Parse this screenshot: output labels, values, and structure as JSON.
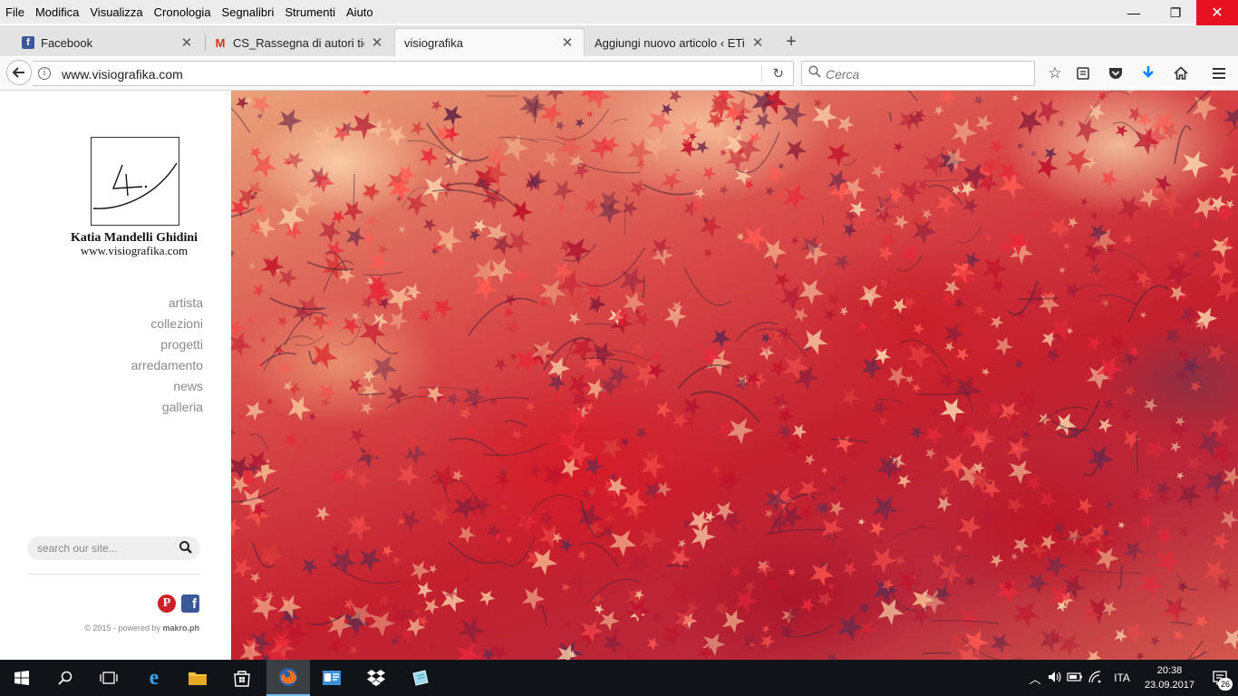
{
  "menubar": {
    "items": [
      "File",
      "Modifica",
      "Visualizza",
      "Cronologia",
      "Segnalibri",
      "Strumenti",
      "Aiuto"
    ]
  },
  "window_controls": {
    "minimize": "—",
    "restore": "❐",
    "close": "✕"
  },
  "tabs": [
    {
      "title": "Facebook",
      "favicon": "facebook-icon"
    },
    {
      "title": "CS_Rassegna di autori ticine",
      "favicon": "gmail-icon"
    },
    {
      "title": "visiografika",
      "favicon": "none",
      "active": true
    },
    {
      "title": "Aggiungi nuovo articolo ‹ ETiCin",
      "favicon": "wordpress-icon"
    }
  ],
  "navbar": {
    "url": "www.visiografika.com",
    "search_placeholder": "Cerca"
  },
  "sidebar": {
    "site_name": "Katia Mandelli Ghidini",
    "site_url": "www.visiografika.com",
    "nav": [
      "artista",
      "collezioni",
      "progetti",
      "arredamento",
      "news",
      "galleria"
    ],
    "search_placeholder": "search our site...",
    "footer_prefix": "© 2015 - powered by ",
    "footer_brand": "makro.ph"
  },
  "taskbar": {
    "language": "ITA",
    "time": "20:38",
    "date": "23.09.2017",
    "notifications": "26"
  },
  "colors": {
    "accent_close": "#e81123",
    "download_arrow": "#0a84ff",
    "pinterest": "#cb2027",
    "facebook": "#3b5998"
  }
}
